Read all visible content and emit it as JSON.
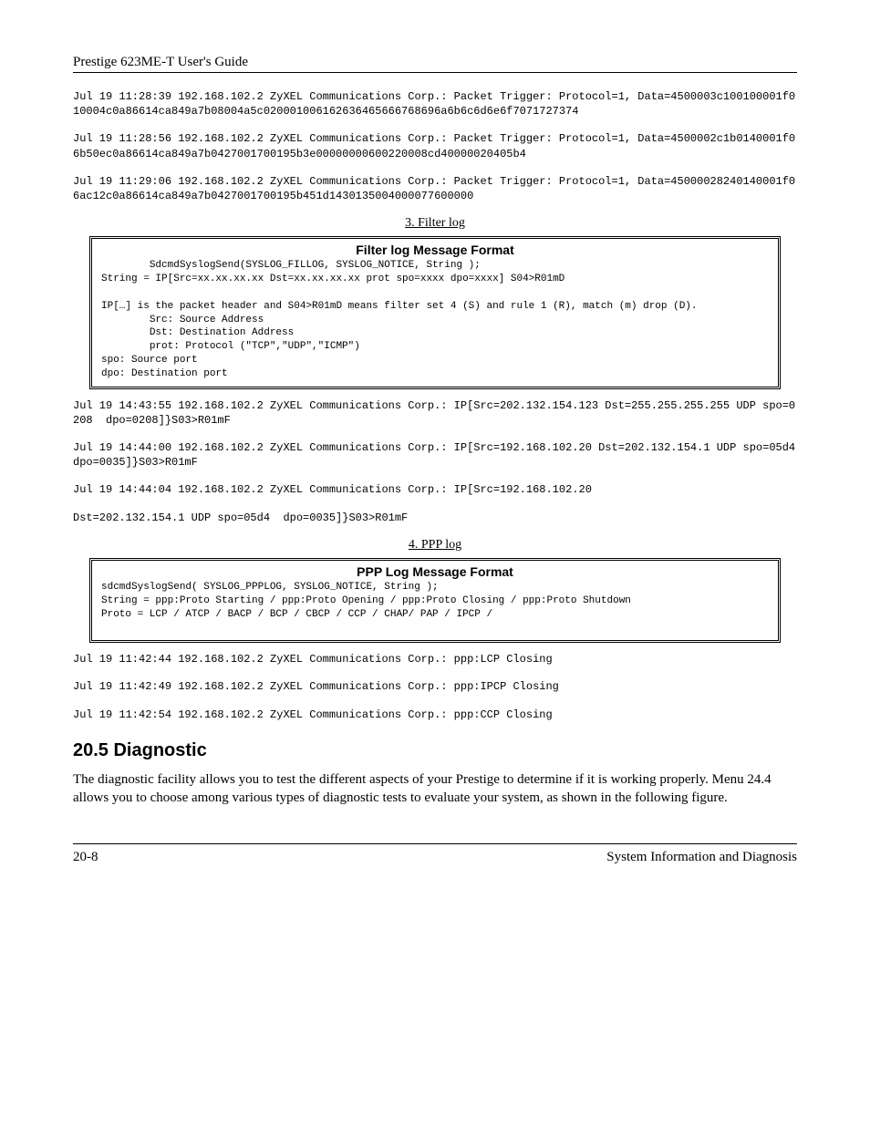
{
  "header": "Prestige 623ME-T User's Guide",
  "log_block_1": "Jul 19 11:28:39 192.168.102.2 ZyXEL Communications Corp.: Packet Trigger: Protocol=1, Data=4500003c100100001f010004c0a86614ca849a7b08004a5c020001006162636465666768696a6b6c6d6e6f7071727374",
  "log_block_2": "Jul 19 11:28:56 192.168.102.2 ZyXEL Communications Corp.: Packet Trigger: Protocol=1, Data=4500002c1b0140001f06b50ec0a86614ca849a7b0427001700195b3e00000000600220008cd40000020405b4",
  "log_block_3": "Jul 19 11:29:06 192.168.102.2 ZyXEL Communications Corp.: Packet Trigger: Protocol=1, Data=45000028240140001f06ac12c0a86614ca849a7b0427001700195b451d1430135004000077600000",
  "section3_label": "3. Filter log",
  "filter_box": {
    "title": "Filter log Message Format",
    "body": "        SdcmdSyslogSend(SYSLOG_FILLOG, SYSLOG_NOTICE, String );\nString = IP[Src=xx.xx.xx.xx Dst=xx.xx.xx.xx prot spo=xxxx dpo=xxxx] S04>R01mD\n\nIP[…] is the packet header and S04>R01mD means filter set 4 (S) and rule 1 (R), match (m) drop (D).\n        Src: Source Address\n        Dst: Destination Address\n        prot: Protocol (\"TCP\",\"UDP\",\"ICMP\")\nspo: Source port\ndpo: Destination port"
  },
  "filter_log_1": "Jul 19 14:43:55 192.168.102.2 ZyXEL Communications Corp.: IP[Src=202.132.154.123 Dst=255.255.255.255 UDP spo=0208  dpo=0208]}S03>R01mF",
  "filter_log_2": "Jul 19 14:44:00 192.168.102.2 ZyXEL Communications Corp.: IP[Src=192.168.102.20 Dst=202.132.154.1 UDP spo=05d4  dpo=0035]}S03>R01mF",
  "filter_log_3": "Jul 19 14:44:04 192.168.102.2 ZyXEL Communications Corp.: IP[Src=192.168.102.20",
  "filter_log_4": "Dst=202.132.154.1 UDP spo=05d4  dpo=0035]}S03>R01mF",
  "section4_label": "4. PPP log",
  "ppp_box": {
    "title": "PPP Log Message Format",
    "body": "sdcmdSyslogSend( SYSLOG_PPPLOG, SYSLOG_NOTICE, String );\nString = ppp:Proto Starting / ppp:Proto Opening / ppp:Proto Closing / ppp:Proto Shutdown\nProto = LCP / ATCP / BACP / BCP / CBCP / CCP / CHAP/ PAP / IPCP /\n\n"
  },
  "ppp_log_1": "Jul 19 11:42:44 192.168.102.2 ZyXEL Communications Corp.: ppp:LCP Closing",
  "ppp_log_2": "Jul 19 11:42:49 192.168.102.2 ZyXEL Communications Corp.: ppp:IPCP Closing",
  "ppp_log_3": "Jul 19 11:42:54 192.168.102.2 ZyXEL Communications Corp.: ppp:CCP Closing",
  "heading": "20.5  Diagnostic",
  "body_text": "The diagnostic facility allows you to test the different aspects of your Prestige to determine if it is working properly. Menu 24.4 allows you to choose among various types of diagnostic tests to evaluate your system, as shown in the following figure.",
  "footer_left": "20-8",
  "footer_right": "System Information and Diagnosis"
}
